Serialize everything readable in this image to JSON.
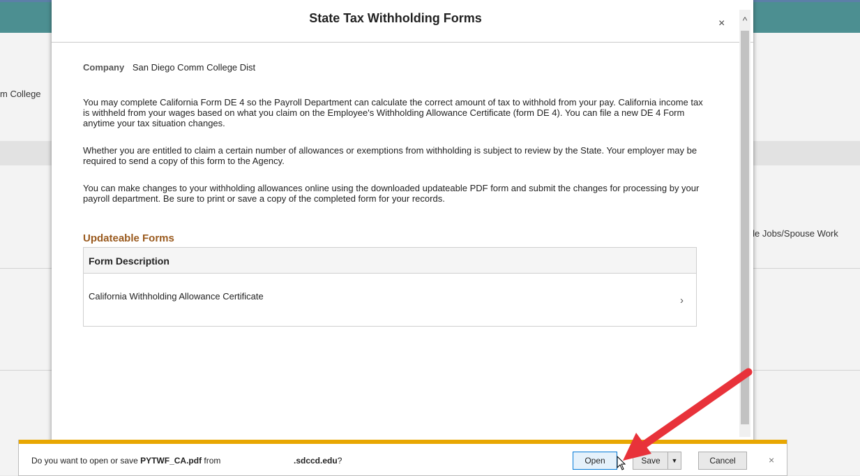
{
  "background": {
    "left_text": "m College",
    "right_text": "iple Jobs/Spouse Work",
    "paren_1": ")",
    "paren_2": ")"
  },
  "modal": {
    "title": "State Tax Withholding Forms",
    "close_label": "×",
    "scroll_up": "^",
    "company_label": "Company",
    "company_value": "San Diego Comm College Dist",
    "paragraph_1": "You may complete California Form DE 4 so the Payroll Department can calculate the correct amount of tax to withhold from your pay.  California income tax is withheld from your wages based on what you claim on the Employee's Withholding Allowance Certificate (form DE 4).  You can file a new DE 4 Form anytime your tax situation changes.",
    "paragraph_2": "Whether you are entitled to claim a certain number of allowances or exemptions from withholding is subject to review by the State. Your employer may be required to send a copy of this form to the Agency.",
    "paragraph_3": "You can make changes to your withholding allowances online using the downloaded updateable PDF form and submit the changes for processing by your payroll department.  Be sure to print or save a copy of the completed form for your records.",
    "section_title": "Updateable Forms",
    "grid": {
      "column_header": "Form Description",
      "rows": [
        {
          "label": "California Withholding Allowance Certificate",
          "chevron": "›"
        }
      ]
    }
  },
  "download_bar": {
    "prompt_prefix": "Do you want to open or save ",
    "file_name": "PYTWF_CA.pdf",
    "prompt_from": " from",
    "domain": ".sdccd.edu",
    "domain_suffix": "?",
    "open_label": "Open",
    "save_label": "Save",
    "save_dropdown": "▼",
    "cancel_label": "Cancel",
    "close_label": "×"
  },
  "colors": {
    "header_teal": "#4c8f91",
    "section_title": "#9a5a1e",
    "download_accent": "#e8a702",
    "arrow": "#e8323a"
  },
  "icons": {
    "close": "close-icon",
    "chevron": "chevron-right-icon",
    "arrow": "red-arrow-annotation-icon",
    "cursor": "mouse-pointer-icon"
  }
}
